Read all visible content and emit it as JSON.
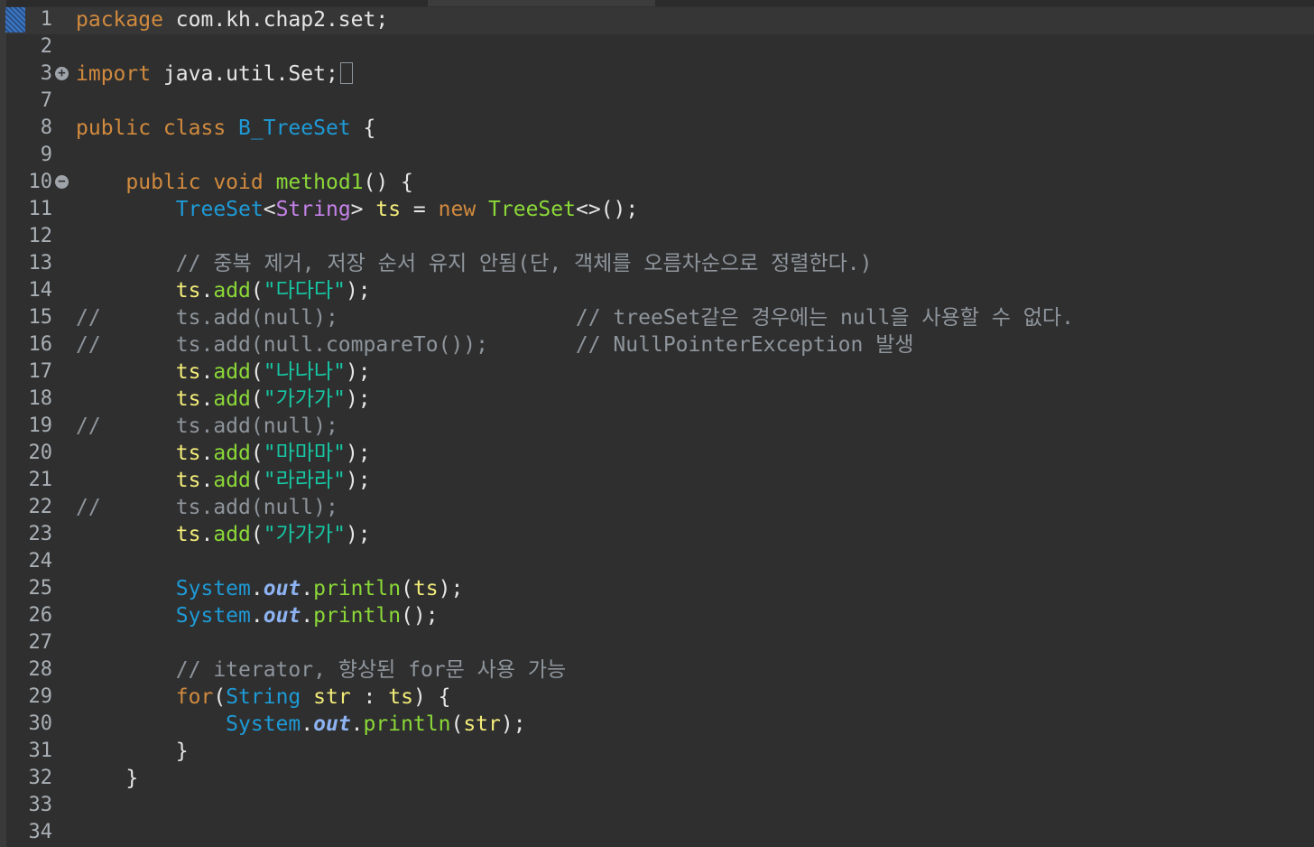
{
  "editor": {
    "lines": [
      {
        "num": "1",
        "fold": "",
        "tokens": [
          {
            "c": "kw",
            "t": "package"
          },
          {
            "c": "pkg",
            "t": " com.kh.chap2.set;"
          }
        ]
      },
      {
        "num": "2",
        "fold": "",
        "tokens": []
      },
      {
        "num": "3",
        "fold": "expand",
        "tokens": [
          {
            "c": "kw",
            "t": "import"
          },
          {
            "c": "pkg",
            "t": " java.util.Set;"
          },
          {
            "c": "box",
            "t": ""
          }
        ]
      },
      {
        "num": "7",
        "fold": "",
        "tokens": []
      },
      {
        "num": "8",
        "fold": "",
        "tokens": [
          {
            "c": "kw",
            "t": "public class"
          },
          {
            "c": "pkg",
            "t": " "
          },
          {
            "c": "type",
            "t": "B_TreeSet"
          },
          {
            "c": "pkg",
            "t": " {"
          }
        ]
      },
      {
        "num": "9",
        "fold": "",
        "tokens": []
      },
      {
        "num": "10",
        "fold": "collapse",
        "tokens": [
          {
            "c": "pkg",
            "t": "    "
          },
          {
            "c": "kw",
            "t": "public void"
          },
          {
            "c": "pkg",
            "t": " "
          },
          {
            "c": "meth",
            "t": "method1"
          },
          {
            "c": "pkg",
            "t": "() {"
          }
        ]
      },
      {
        "num": "11",
        "fold": "",
        "tokens": [
          {
            "c": "pkg",
            "t": "        "
          },
          {
            "c": "type",
            "t": "TreeSet"
          },
          {
            "c": "pkg",
            "t": "<"
          },
          {
            "c": "tpar",
            "t": "String"
          },
          {
            "c": "pkg",
            "t": "> "
          },
          {
            "c": "var",
            "t": "ts"
          },
          {
            "c": "pkg",
            "t": " = "
          },
          {
            "c": "kw",
            "t": "new"
          },
          {
            "c": "pkg",
            "t": " "
          },
          {
            "c": "meth",
            "t": "TreeSet"
          },
          {
            "c": "pkg",
            "t": "<>();"
          }
        ]
      },
      {
        "num": "12",
        "fold": "",
        "tokens": []
      },
      {
        "num": "13",
        "fold": "",
        "tokens": [
          {
            "c": "pkg",
            "t": "        "
          },
          {
            "c": "cmt",
            "t": "// 중복 제거, 저장 순서 유지 안됨(단, 객체를 오름차순으로 정렬한다.)"
          }
        ]
      },
      {
        "num": "14",
        "fold": "",
        "tokens": [
          {
            "c": "pkg",
            "t": "        "
          },
          {
            "c": "var",
            "t": "ts"
          },
          {
            "c": "pkg",
            "t": "."
          },
          {
            "c": "meth",
            "t": "add"
          },
          {
            "c": "pkg",
            "t": "("
          },
          {
            "c": "str",
            "t": "\"다다다\""
          },
          {
            "c": "pkg",
            "t": ");"
          }
        ]
      },
      {
        "num": "15",
        "fold": "",
        "tokens": [
          {
            "c": "cmt",
            "t": "//      ts.add(null);                   // treeSet같은 경우에는 null을 사용할 수 없다."
          }
        ]
      },
      {
        "num": "16",
        "fold": "",
        "tokens": [
          {
            "c": "cmt",
            "t": "//      ts.add(null.compareTo());       // NullPointerException 발생"
          }
        ]
      },
      {
        "num": "17",
        "fold": "",
        "tokens": [
          {
            "c": "pkg",
            "t": "        "
          },
          {
            "c": "var",
            "t": "ts"
          },
          {
            "c": "pkg",
            "t": "."
          },
          {
            "c": "meth",
            "t": "add"
          },
          {
            "c": "pkg",
            "t": "("
          },
          {
            "c": "str",
            "t": "\"나나나\""
          },
          {
            "c": "pkg",
            "t": ");"
          }
        ]
      },
      {
        "num": "18",
        "fold": "",
        "tokens": [
          {
            "c": "pkg",
            "t": "        "
          },
          {
            "c": "var",
            "t": "ts"
          },
          {
            "c": "pkg",
            "t": "."
          },
          {
            "c": "meth",
            "t": "add"
          },
          {
            "c": "pkg",
            "t": "("
          },
          {
            "c": "str",
            "t": "\"가가가\""
          },
          {
            "c": "pkg",
            "t": ");"
          }
        ]
      },
      {
        "num": "19",
        "fold": "",
        "tokens": [
          {
            "c": "cmt",
            "t": "//      ts.add(null);"
          }
        ]
      },
      {
        "num": "20",
        "fold": "",
        "tokens": [
          {
            "c": "pkg",
            "t": "        "
          },
          {
            "c": "var",
            "t": "ts"
          },
          {
            "c": "pkg",
            "t": "."
          },
          {
            "c": "meth",
            "t": "add"
          },
          {
            "c": "pkg",
            "t": "("
          },
          {
            "c": "str",
            "t": "\"마마마\""
          },
          {
            "c": "pkg",
            "t": ");"
          }
        ]
      },
      {
        "num": "21",
        "fold": "",
        "tokens": [
          {
            "c": "pkg",
            "t": "        "
          },
          {
            "c": "var",
            "t": "ts"
          },
          {
            "c": "pkg",
            "t": "."
          },
          {
            "c": "meth",
            "t": "add"
          },
          {
            "c": "pkg",
            "t": "("
          },
          {
            "c": "str",
            "t": "\"라라라\""
          },
          {
            "c": "pkg",
            "t": ");"
          }
        ]
      },
      {
        "num": "22",
        "fold": "",
        "tokens": [
          {
            "c": "cmt",
            "t": "//      ts.add(null);"
          }
        ]
      },
      {
        "num": "23",
        "fold": "",
        "tokens": [
          {
            "c": "pkg",
            "t": "        "
          },
          {
            "c": "var",
            "t": "ts"
          },
          {
            "c": "pkg",
            "t": "."
          },
          {
            "c": "meth",
            "t": "add"
          },
          {
            "c": "pkg",
            "t": "("
          },
          {
            "c": "str",
            "t": "\"가가가\""
          },
          {
            "c": "pkg",
            "t": ");"
          }
        ]
      },
      {
        "num": "24",
        "fold": "",
        "tokens": []
      },
      {
        "num": "25",
        "fold": "",
        "tokens": [
          {
            "c": "pkg",
            "t": "        "
          },
          {
            "c": "type",
            "t": "System"
          },
          {
            "c": "pkg",
            "t": "."
          },
          {
            "c": "field",
            "t": "out"
          },
          {
            "c": "pkg",
            "t": "."
          },
          {
            "c": "meth",
            "t": "println"
          },
          {
            "c": "pkg",
            "t": "("
          },
          {
            "c": "var",
            "t": "ts"
          },
          {
            "c": "pkg",
            "t": ");"
          }
        ]
      },
      {
        "num": "26",
        "fold": "",
        "tokens": [
          {
            "c": "pkg",
            "t": "        "
          },
          {
            "c": "type",
            "t": "System"
          },
          {
            "c": "pkg",
            "t": "."
          },
          {
            "c": "field",
            "t": "out"
          },
          {
            "c": "pkg",
            "t": "."
          },
          {
            "c": "meth",
            "t": "println"
          },
          {
            "c": "pkg",
            "t": "();"
          }
        ]
      },
      {
        "num": "27",
        "fold": "",
        "tokens": []
      },
      {
        "num": "28",
        "fold": "",
        "tokens": [
          {
            "c": "pkg",
            "t": "        "
          },
          {
            "c": "cmt",
            "t": "// iterator, 향상된 for문 사용 가능"
          }
        ]
      },
      {
        "num": "29",
        "fold": "",
        "tokens": [
          {
            "c": "pkg",
            "t": "        "
          },
          {
            "c": "kw",
            "t": "for"
          },
          {
            "c": "pkg",
            "t": "("
          },
          {
            "c": "type",
            "t": "String"
          },
          {
            "c": "pkg",
            "t": " "
          },
          {
            "c": "var",
            "t": "str"
          },
          {
            "c": "pkg",
            "t": " : "
          },
          {
            "c": "var",
            "t": "ts"
          },
          {
            "c": "pkg",
            "t": ") {"
          }
        ]
      },
      {
        "num": "30",
        "fold": "",
        "tokens": [
          {
            "c": "pkg",
            "t": "            "
          },
          {
            "c": "type",
            "t": "System"
          },
          {
            "c": "pkg",
            "t": "."
          },
          {
            "c": "field",
            "t": "out"
          },
          {
            "c": "pkg",
            "t": "."
          },
          {
            "c": "meth",
            "t": "println"
          },
          {
            "c": "pkg",
            "t": "("
          },
          {
            "c": "var",
            "t": "str"
          },
          {
            "c": "pkg",
            "t": ");"
          }
        ]
      },
      {
        "num": "31",
        "fold": "",
        "tokens": [
          {
            "c": "pkg",
            "t": "        }"
          }
        ]
      },
      {
        "num": "32",
        "fold": "",
        "tokens": [
          {
            "c": "pkg",
            "t": "    }"
          }
        ]
      },
      {
        "num": "33",
        "fold": "",
        "tokens": []
      },
      {
        "num": "34",
        "fold": "",
        "tokens": []
      }
    ]
  }
}
